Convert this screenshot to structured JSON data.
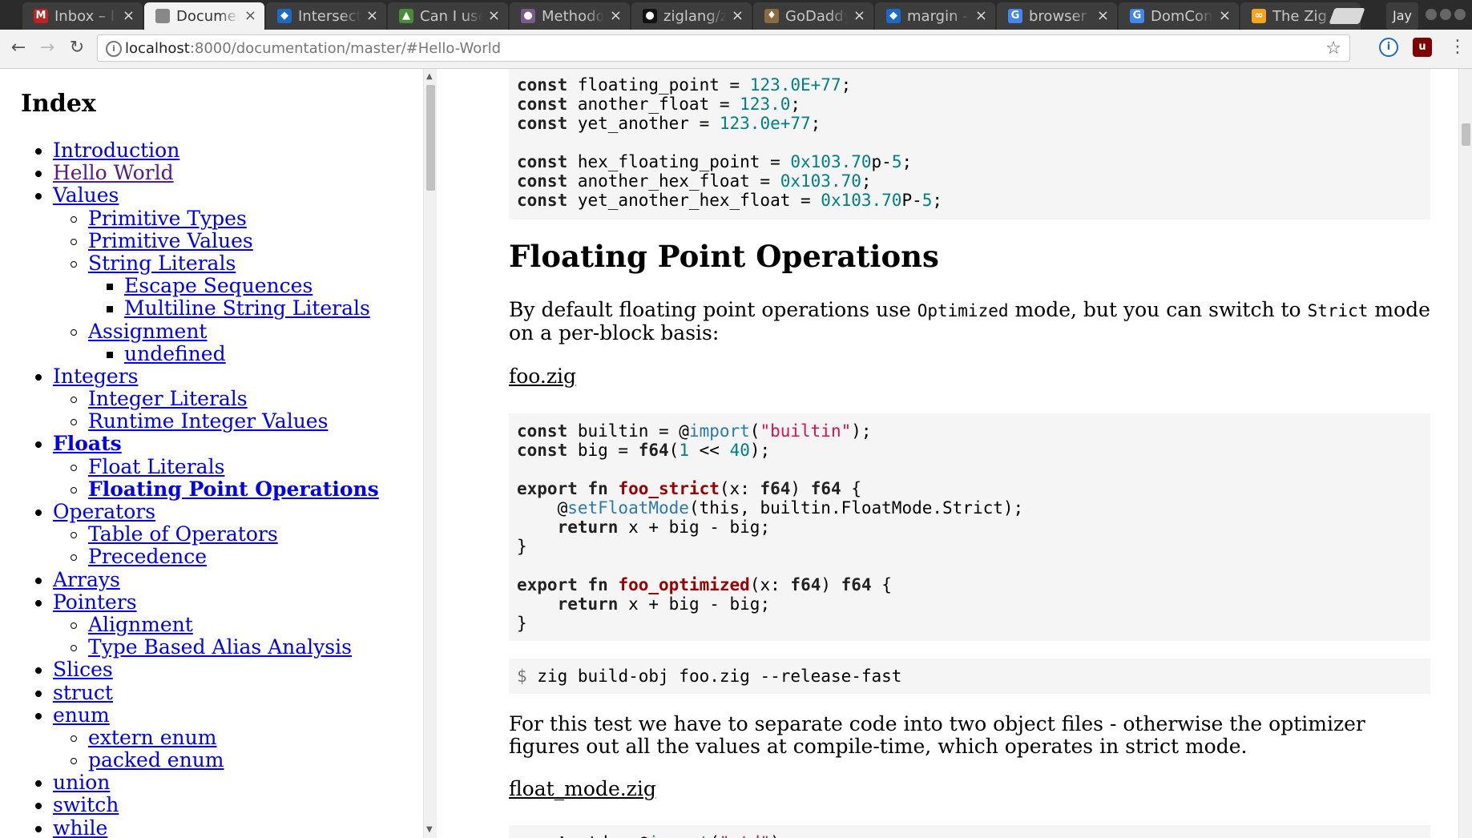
{
  "tabs": [
    {
      "title": "Inbox – Ins",
      "icon": "gmail-icon",
      "color": "#c5221f",
      "glyph": "M",
      "active": false
    },
    {
      "title": "Documentati",
      "icon": "document-icon",
      "color": "#888888",
      "glyph": "",
      "active": true
    },
    {
      "title": "Intersection",
      "icon": "mdn-icon",
      "color": "#1b6ac6",
      "glyph": "◆",
      "active": false
    },
    {
      "title": "Can I use",
      "icon": "caniuse-icon",
      "color": "#4a8b3a",
      "glyph": "▲",
      "active": false
    },
    {
      "title": "Methodolog",
      "icon": "avatar-icon",
      "color": "#7a5a8a",
      "glyph": "●",
      "active": false
    },
    {
      "title": "ziglang/zig",
      "icon": "github-icon",
      "color": "#111111",
      "glyph": "●",
      "active": false
    },
    {
      "title": "GoDaddy",
      "icon": "godaddy-icon",
      "color": "#8a6a40",
      "glyph": "♦",
      "active": false
    },
    {
      "title": "margin - CSS",
      "icon": "mdn-icon",
      "color": "#1b6ac6",
      "glyph": "◆",
      "active": false
    },
    {
      "title": "browser",
      "icon": "google-icon",
      "color": "#4285f4",
      "glyph": "G",
      "active": false
    },
    {
      "title": "DomConte",
      "icon": "google-icon",
      "color": "#4285f4",
      "glyph": "G",
      "active": false
    },
    {
      "title": "The Zig",
      "icon": "zig-icon",
      "color": "#f7a41d",
      "glyph": "∞",
      "active": false
    }
  ],
  "profile": "Jay",
  "address": {
    "host": "localhost",
    "path": ":8000/documentation/master/#Hello-World"
  },
  "index_title": "Index",
  "toc": [
    {
      "label": "Introduction",
      "level": 1
    },
    {
      "label": "Hello World",
      "level": 1,
      "visited": true
    },
    {
      "label": "Values",
      "level": 1
    },
    {
      "label": "Primitive Types",
      "level": 2
    },
    {
      "label": "Primitive Values",
      "level": 2
    },
    {
      "label": "String Literals",
      "level": 2
    },
    {
      "label": "Escape Sequences",
      "level": 3
    },
    {
      "label": "Multiline String Literals",
      "level": 3
    },
    {
      "label": "Assignment",
      "level": 2
    },
    {
      "label": "undefined",
      "level": 3
    },
    {
      "label": "Integers",
      "level": 1
    },
    {
      "label": "Integer Literals",
      "level": 2
    },
    {
      "label": "Runtime Integer Values",
      "level": 2
    },
    {
      "label": "Floats",
      "level": 1,
      "bold": true
    },
    {
      "label": "Float Literals",
      "level": 2
    },
    {
      "label": "Floating Point Operations",
      "level": 2,
      "bold": true
    },
    {
      "label": "Operators",
      "level": 1
    },
    {
      "label": "Table of Operators",
      "level": 2
    },
    {
      "label": "Precedence",
      "level": 2
    },
    {
      "label": "Arrays",
      "level": 1
    },
    {
      "label": "Pointers",
      "level": 1
    },
    {
      "label": "Alignment",
      "level": 2
    },
    {
      "label": "Type Based Alias Analysis",
      "level": 2
    },
    {
      "label": "Slices",
      "level": 1
    },
    {
      "label": "struct",
      "level": 1
    },
    {
      "label": "enum",
      "level": 1
    },
    {
      "label": "extern enum",
      "level": 2
    },
    {
      "label": "packed enum",
      "level": 2
    },
    {
      "label": "union",
      "level": 1
    },
    {
      "label": "switch",
      "level": 1
    },
    {
      "label": "while",
      "level": 1
    }
  ],
  "code_block_1": [
    [
      [
        "kw",
        "const"
      ],
      [
        "t",
        " floating_point = "
      ],
      [
        "num",
        "123.0E+77"
      ],
      [
        "t",
        ";"
      ]
    ],
    [
      [
        "kw",
        "const"
      ],
      [
        "t",
        " another_float = "
      ],
      [
        "num",
        "123.0"
      ],
      [
        "t",
        ";"
      ]
    ],
    [
      [
        "kw",
        "const"
      ],
      [
        "t",
        " yet_another = "
      ],
      [
        "num",
        "123.0e+77"
      ],
      [
        "t",
        ";"
      ]
    ],
    [],
    [
      [
        "kw",
        "const"
      ],
      [
        "t",
        " hex_floating_point = "
      ],
      [
        "num",
        "0x103.70"
      ],
      [
        "t",
        "p-"
      ],
      [
        "num",
        "5"
      ],
      [
        "t",
        ";"
      ]
    ],
    [
      [
        "kw",
        "const"
      ],
      [
        "t",
        " another_hex_float = "
      ],
      [
        "num",
        "0x103.70"
      ],
      [
        "t",
        ";"
      ]
    ],
    [
      [
        "kw",
        "const"
      ],
      [
        "t",
        " yet_another_hex_float = "
      ],
      [
        "num",
        "0x103.70"
      ],
      [
        "t",
        "P-"
      ],
      [
        "num",
        "5"
      ],
      [
        "t",
        ";"
      ]
    ]
  ],
  "section_title": "Floating Point Operations",
  "intro": {
    "before": "By default floating point operations use ",
    "code1": "Optimized",
    "middle": " mode, but you can switch to ",
    "code2": "Strict",
    "after": " mode on a per-block basis:"
  },
  "file1": "foo.zig",
  "code_block_2": [
    [
      [
        "kw",
        "const"
      ],
      [
        "t",
        " builtin = @"
      ],
      [
        "fn",
        "import"
      ],
      [
        "t",
        "("
      ],
      [
        "str",
        "\"builtin\""
      ],
      [
        "t",
        ");"
      ]
    ],
    [
      [
        "kw",
        "const"
      ],
      [
        "t",
        " big = "
      ],
      [
        "ty",
        "f64"
      ],
      [
        "t",
        "("
      ],
      [
        "num",
        "1"
      ],
      [
        "t",
        " << "
      ],
      [
        "num",
        "40"
      ],
      [
        "t",
        ");"
      ]
    ],
    [],
    [
      [
        "kw",
        "export"
      ],
      [
        "t",
        " "
      ],
      [
        "kw",
        "fn"
      ],
      [
        "t",
        " "
      ],
      [
        "fname",
        "foo_strict"
      ],
      [
        "t",
        "(x: "
      ],
      [
        "ty",
        "f64"
      ],
      [
        "t",
        ") "
      ],
      [
        "ty",
        "f64"
      ],
      [
        "t",
        " {"
      ]
    ],
    [
      [
        "t",
        "    @"
      ],
      [
        "fn",
        "setFloatMode"
      ],
      [
        "t",
        "(this, builtin.FloatMode.Strict);"
      ]
    ],
    [
      [
        "t",
        "    "
      ],
      [
        "kw",
        "return"
      ],
      [
        "t",
        " x + big - big;"
      ]
    ],
    [
      [
        "t",
        "}"
      ]
    ],
    [],
    [
      [
        "kw",
        "export"
      ],
      [
        "t",
        " "
      ],
      [
        "kw",
        "fn"
      ],
      [
        "t",
        " "
      ],
      [
        "fname",
        "foo_optimized"
      ],
      [
        "t",
        "(x: "
      ],
      [
        "ty",
        "f64"
      ],
      [
        "t",
        ") "
      ],
      [
        "ty",
        "f64"
      ],
      [
        "t",
        " {"
      ]
    ],
    [
      [
        "t",
        "    "
      ],
      [
        "kw",
        "return"
      ],
      [
        "t",
        " x + big - big;"
      ]
    ],
    [
      [
        "t",
        "}"
      ]
    ]
  ],
  "shell": {
    "prompt": "$",
    "command": " zig build-obj foo.zig --release-fast"
  },
  "para2": "For this test we have to separate code into two object files - otherwise the optimizer figures out all the values at compile-time, which operates in strict mode.",
  "file2": "float_mode.zig",
  "code_block_3_partial": [
    [
      [
        "kw",
        "const"
      ],
      [
        "t",
        " std = @"
      ],
      [
        "fn",
        "import"
      ],
      [
        "t",
        "("
      ],
      [
        "str",
        "\"std\""
      ],
      [
        "t",
        ");"
      ]
    ]
  ]
}
